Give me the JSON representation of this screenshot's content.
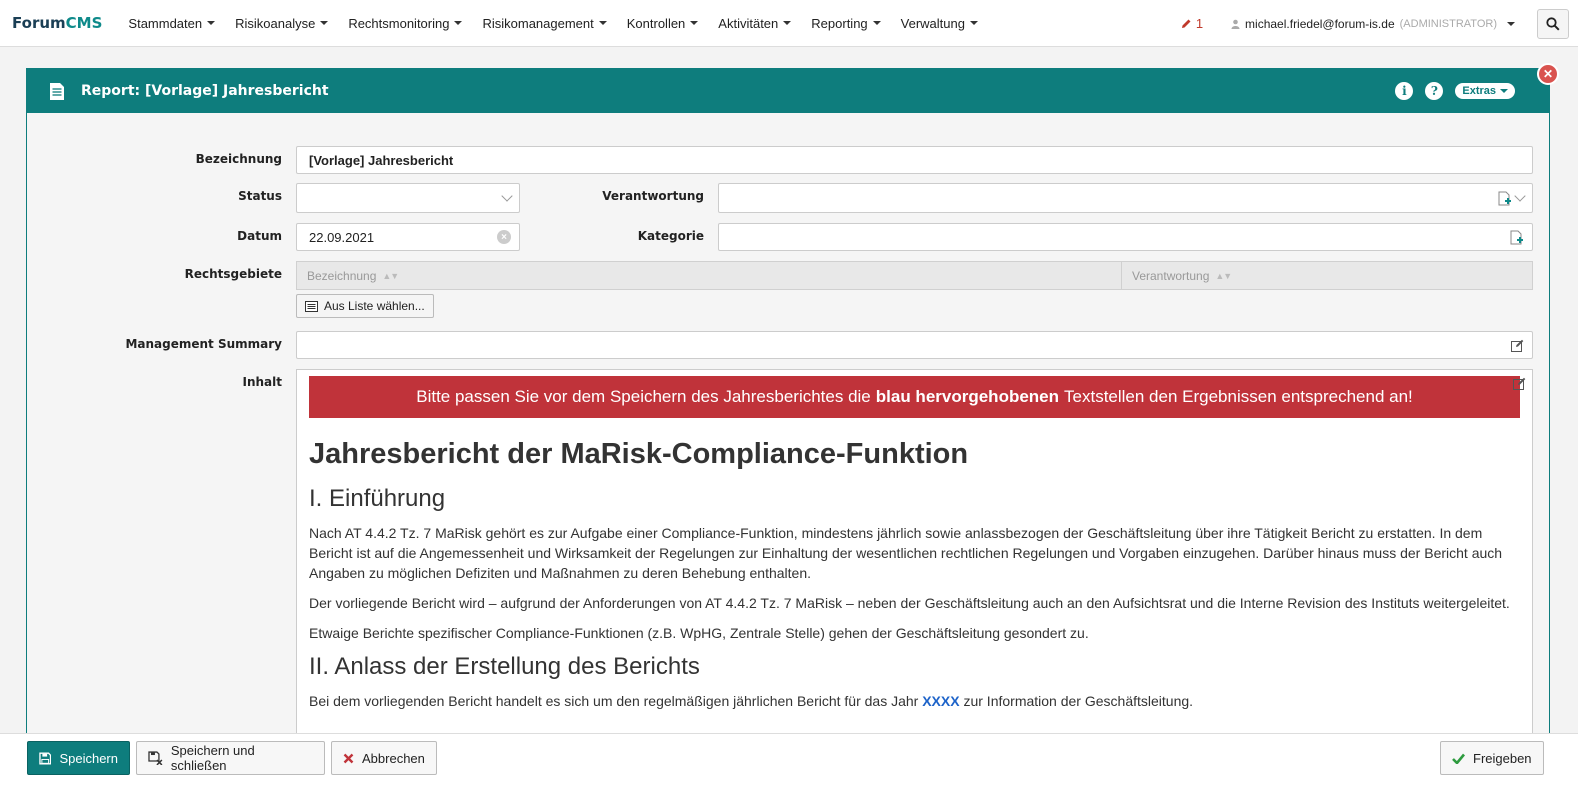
{
  "brand": {
    "part1": "Forum",
    "part2": "CMS"
  },
  "menu": [
    "Stammdaten",
    "Risikoanalyse",
    "Rechtsmonitoring",
    "Risikomanagement",
    "Kontrollen",
    "Aktivitäten",
    "Reporting",
    "Verwaltung"
  ],
  "notifications": {
    "count": "1"
  },
  "user": {
    "email": "michael.friedel@forum-is.de",
    "role": "(ADMINISTRATOR)"
  },
  "panel": {
    "title": "Report: [Vorlage] Jahresbericht",
    "extras_label": "Extras",
    "close_label": "✕"
  },
  "form": {
    "bezeichnung_label": "Bezeichnung",
    "bezeichnung_value": "[Vorlage] Jahresbericht",
    "status_label": "Status",
    "status_value": "",
    "verantwortung_label": "Verantwortung",
    "datum_label": "Datum",
    "datum_value": "22.09.2021",
    "kategorie_label": "Kategorie",
    "rechtsgebiete_label": "Rechtsgebiete",
    "grid_col1": "Bezeichnung",
    "grid_col2": "Verantwortung",
    "aus_liste_label": "Aus Liste wählen...",
    "management_summary_label": "Management Summary",
    "inhalt_label": "Inhalt"
  },
  "content": {
    "notice_pre": "Bitte passen Sie vor dem Speichern des Jahresberichtes die",
    "notice_bold": "blau hervorgehobenen",
    "notice_post": "Textstellen den Ergebnissen entsprechend an!",
    "h1": "Jahresbericht der MaRisk-Compliance-Funktion",
    "h2_1": "I. Einführung",
    "p1": "Nach AT 4.4.2 Tz. 7 MaRisk gehört es zur Aufgabe einer Compliance-Funktion, mindestens jährlich sowie anlassbezogen der Geschäftsleitung über ihre Tätigkeit Bericht zu erstatten. In dem Bericht ist auf die Angemessenheit und Wirksamkeit der Regelungen zur Einhaltung der wesentlichen rechtlichen Regelungen und Vorgaben einzugehen. Darüber hinaus muss der Bericht auch Angaben zu möglichen Defiziten und Maßnahmen zu deren Behebung enthalten.",
    "p2": "Der vorliegende Bericht wird – aufgrund der Anforderungen von AT 4.4.2 Tz. 7 MaRisk – neben der Geschäftsleitung auch an den Aufsichtsrat und die Interne Revision des Instituts weitergeleitet.",
    "p3": "Etwaige Berichte spezifischer Compliance-Funktionen (z.B. WpHG, Zentrale Stelle) gehen der Geschäftsleitung gesondert zu.",
    "h2_2": "II. Anlass der Erstellung des Berichts",
    "p4_pre": "Bei dem vorliegenden Bericht handelt es sich um den regelmäßigen jährlichen Bericht für das Jahr",
    "p4_hl": "XXXX",
    "p4_post": "zur Information der Geschäftsleitung."
  },
  "footer": {
    "save": "Speichern",
    "save_close": "Speichern und schließen",
    "cancel": "Abbrechen",
    "release": "Freigeben"
  },
  "colors": {
    "accent": "#0e7d7d",
    "notice": "#c0333a",
    "highlight": "#1d63c9",
    "danger": "#d9534f",
    "brand_dark": "#1b3f55"
  }
}
